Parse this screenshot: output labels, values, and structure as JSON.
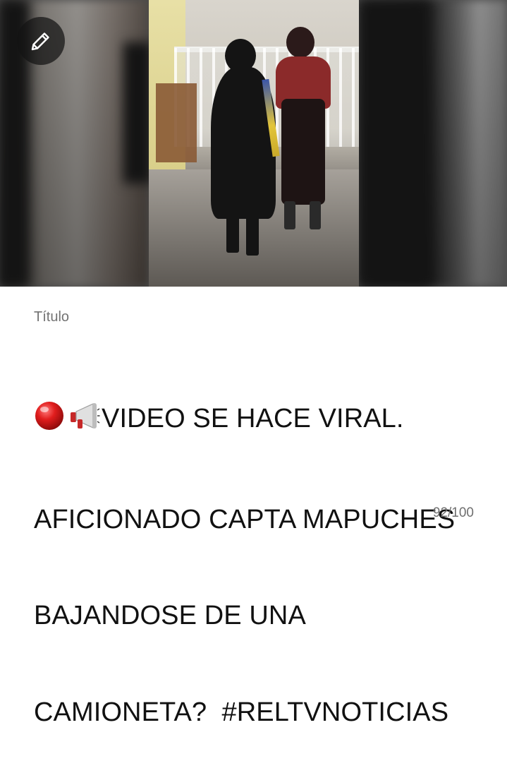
{
  "field": {
    "label": "Título",
    "counter": "92/100"
  },
  "title": {
    "emoji": [
      "red-circle",
      "megaphone"
    ],
    "lines": [
      "VIDEO SE HACE VIRAL.",
      "AFICIONADO CAPTA MAPUCHES",
      "BAJANDOSE DE UNA",
      "CAMIONETA?  #RELTVNOTICIAS"
    ]
  },
  "icons": {
    "edit": "pencil-icon"
  }
}
